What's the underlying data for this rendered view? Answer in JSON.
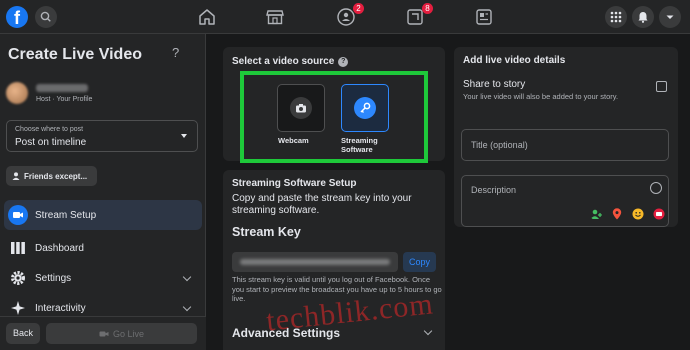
{
  "topbar": {
    "logo_letter": "f",
    "nav": [
      {
        "name": "home",
        "badge": ""
      },
      {
        "name": "marketplace",
        "badge": ""
      },
      {
        "name": "groups",
        "badge": "2"
      },
      {
        "name": "gaming",
        "badge": "8"
      },
      {
        "name": "news",
        "badge": ""
      }
    ]
  },
  "sidebar": {
    "title": "Create Live Video",
    "help": "?",
    "host_subtitle": "Host · Your Profile",
    "choose_label": "Choose where to post",
    "choose_value": "Post on timeline",
    "friends_label": "Friends except...",
    "items": [
      {
        "label": "Stream Setup",
        "active": true
      },
      {
        "label": "Dashboard"
      },
      {
        "label": "Settings"
      },
      {
        "label": "Interactivity"
      }
    ],
    "back_label": "Back",
    "golive_label": "Go Live"
  },
  "video_source": {
    "title": "Select a video source",
    "info": "?",
    "options": [
      {
        "label": "Webcam"
      },
      {
        "label": "Streaming Software",
        "selected": true
      }
    ]
  },
  "streaming_setup": {
    "title": "Streaming Software Setup",
    "description": "Copy and paste the stream key into your streaming software.",
    "key_title": "Stream Key",
    "copy_label": "Copy",
    "key_note": "This stream key is valid until you log out of Facebook. Once you start to preview the broadcast you have up to 5 hours to go live.",
    "advanced_title": "Advanced Settings"
  },
  "details": {
    "title": "Add live video details",
    "share_title": "Share to story",
    "share_desc": "Your live video will also be added to your story.",
    "title_placeholder": "Title (optional)",
    "description_placeholder": "Description",
    "icon_colors": {
      "tag": "#45bd62",
      "location": "#f5533d",
      "feeling": "#f7b928",
      "live": "#e41e3f"
    }
  },
  "watermark": "techblik.com"
}
